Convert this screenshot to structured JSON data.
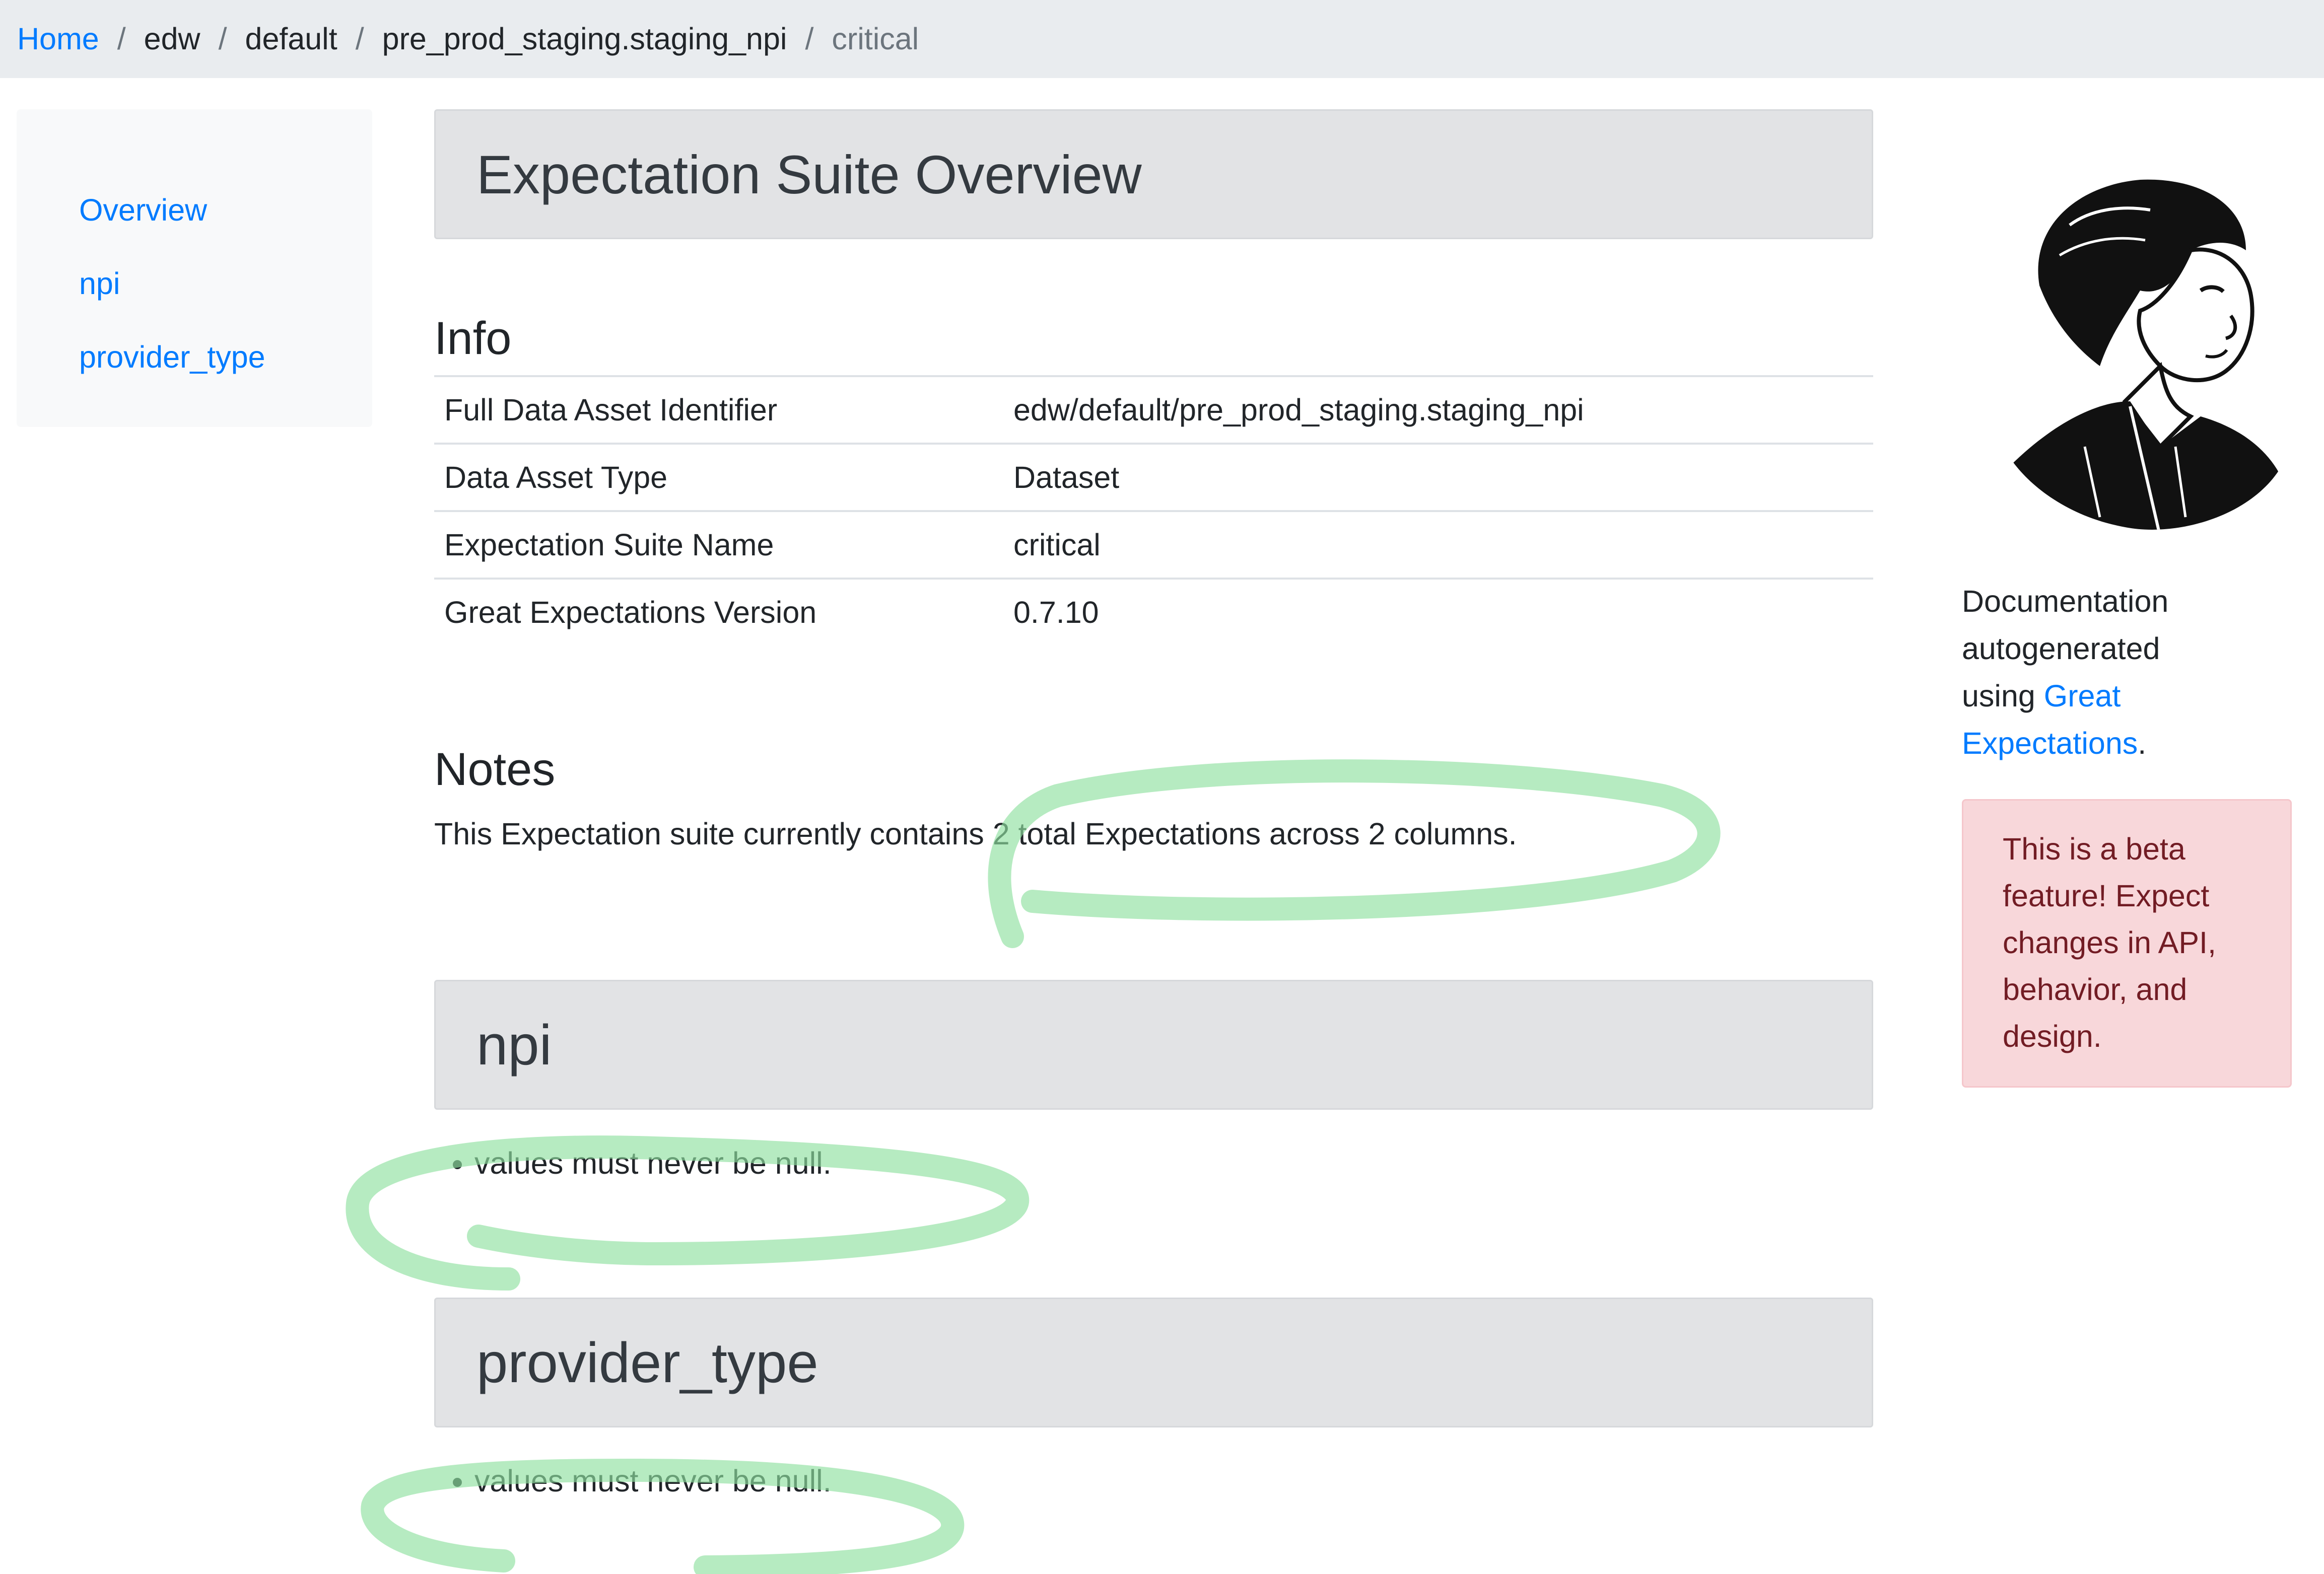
{
  "breadcrumb": {
    "home": "Home",
    "sep": "/",
    "items": [
      "edw",
      "default",
      "pre_prod_staging.staging_npi"
    ],
    "active": "critical"
  },
  "sidebar": {
    "items": [
      {
        "label": "Overview"
      },
      {
        "label": "npi"
      },
      {
        "label": "provider_type"
      }
    ]
  },
  "main": {
    "title": "Expectation Suite Overview",
    "info": {
      "heading": "Info",
      "rows": [
        {
          "key": "Full Data Asset Identifier",
          "value": "edw/default/pre_prod_staging.staging_npi"
        },
        {
          "key": "Data Asset Type",
          "value": "Dataset"
        },
        {
          "key": "Expectation Suite Name",
          "value": "critical"
        },
        {
          "key": "Great Expectations Version",
          "value": "0.7.10"
        }
      ]
    },
    "notes": {
      "heading": "Notes",
      "text": "This Expectation suite currently contains 2 total Expectations across 2 columns."
    },
    "columns": [
      {
        "name": "npi",
        "expectations": [
          "values must never be null."
        ]
      },
      {
        "name": "provider_type",
        "expectations": [
          "values must never be null."
        ]
      }
    ]
  },
  "right": {
    "doc_line1": "Documentation",
    "doc_line2": "autogenerated",
    "doc_using": "using ",
    "doc_link1": "Great",
    "doc_link2": "Expectations",
    "doc_period": ".",
    "alert": "This is a beta feature! Expect changes in API, behavior, and design."
  },
  "colors": {
    "link": "#007bff",
    "breadcrumb_bg": "#e9ecef",
    "header_bg": "#e2e3e5",
    "alert_bg": "#f8d7da",
    "alert_text": "#721c24",
    "highlight": "#8fe0a0"
  },
  "icons": [
    "great-expectations-logo"
  ]
}
